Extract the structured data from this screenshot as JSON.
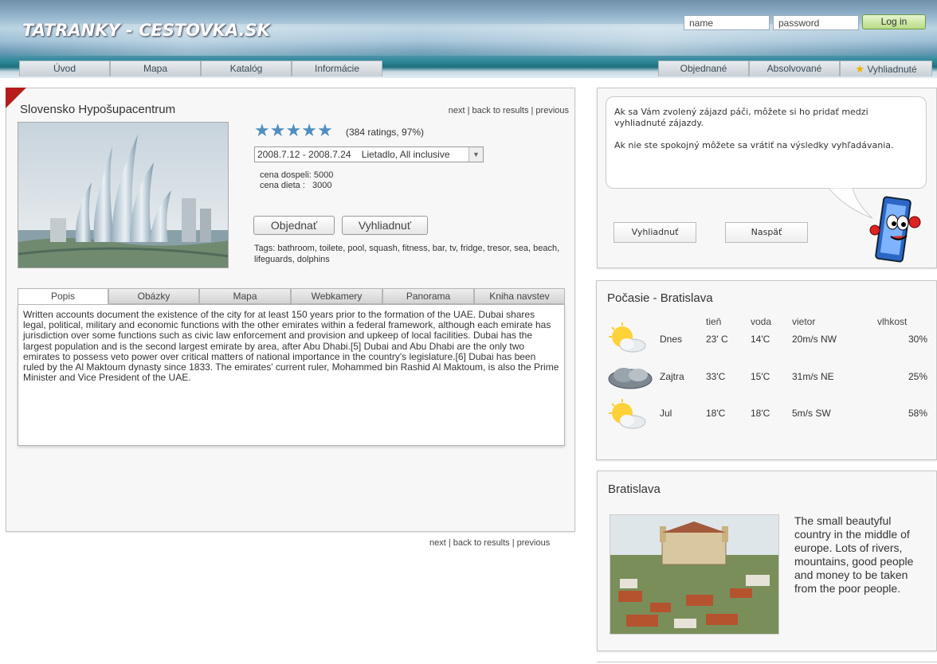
{
  "header": {
    "logo": "TATRANKY - CESTOVKA.SK",
    "name_placeholder": "name",
    "password_placeholder": "password",
    "login_label": "Log in",
    "nav_left": [
      "Úvod",
      "Mapa",
      "Katalóg",
      "Informácie"
    ],
    "nav_right": [
      "Objednané",
      "Absolvované",
      "Vyhliadnuté"
    ]
  },
  "hotel": {
    "title": "Slovensko Hypošupacentrum",
    "nav_links": "next | back to results | previous",
    "rating_stars": 5,
    "ratings_text": "(384 ratings, 97%)",
    "selected_term": "2008.7.12 - 2008.7.24    Lietadlo, All inclusive",
    "price_adult": "cena dospeli: 5000",
    "price_child": "cena dieta :   3000",
    "order_label": "Objednať",
    "watch_label": "Vyhliadnuť",
    "tags": "Tags: bathroom, toilete, pool, squash, fitness, bar, tv, fridge, tresor, sea, beach,  lifeguards, dolphins",
    "tabs": [
      "Popis",
      "Obázky",
      "Mapa",
      "Webkamery",
      "Panorama",
      "Kniha navstev"
    ],
    "description": "Written accounts document the existence of the city for at least 150 years prior to the formation of the UAE. Dubai shares legal, political, military and economic functions with the other emirates within a federal framework, although each emirate has jurisdiction over some functions such as civic law enforcement and provision and upkeep of local facilities. Dubai has the largest population and is the second largest emirate by area, after Abu Dhabi.[5] Dubai and Abu Dhabi are the only two emirates to possess veto power over critical matters of national importance in the country's legislature.[6] Dubai has been ruled by the Al Maktoum dynasty since 1833. The emirates' current ruler, Mohammed bin Rashid Al Maktoum, is also the Prime Minister and Vice President of the UAE."
  },
  "comic": {
    "line1": "Ak sa Vám zvolený zájazd páči, môžete si ho pridať medzi vyhliadnuté zájazdy.",
    "line2": "Ak nie ste spokojný môžete sa vrátiť na výsledky vyhľadávania.",
    "watch_label": "Vyhliadnuť",
    "back_label": "Naspäť"
  },
  "weather": {
    "title": "Počasie - Bratislava",
    "headers": [
      "tieň",
      "voda",
      "vietor",
      "vlhkost"
    ],
    "rows": [
      {
        "day": "Dnes",
        "icon": "sun-cloud-icon",
        "shade": "23' C",
        "water": "14'C",
        "wind": "20m/s NW",
        "humidity": "30%"
      },
      {
        "day": "Zajtra",
        "icon": "storm-cloud-icon",
        "shade": "33'C",
        "water": "15'C",
        "wind": "31m/s NE",
        "humidity": "25%"
      },
      {
        "day": "Jul",
        "icon": "sun-cloud-icon",
        "shade": "18'C",
        "water": "18'C",
        "wind": "5m/s SW",
        "humidity": "58%"
      }
    ]
  },
  "city": {
    "title": "Bratislava",
    "text": "The small beautyful country in the middle of europe. Lots of rivers, mountains, good people and money to be taken from the poor people."
  }
}
